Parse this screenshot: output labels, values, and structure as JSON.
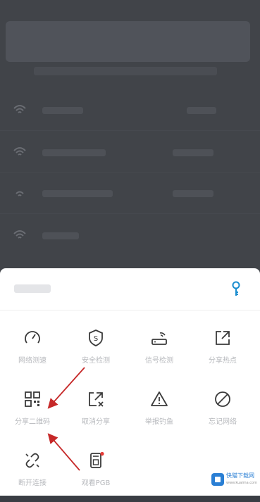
{
  "background_list": {
    "title": "",
    "rows": [
      {},
      {},
      {},
      {}
    ]
  },
  "sheet": {
    "title": "",
    "items": [
      {
        "label": "网络测速",
        "icon": "speedometer-icon"
      },
      {
        "label": "安全检测",
        "icon": "shield-icon"
      },
      {
        "label": "信号检测",
        "icon": "router-icon"
      },
      {
        "label": "分享热点",
        "icon": "share-out-icon"
      },
      {
        "label": "分享二维码",
        "icon": "qr-code-icon"
      },
      {
        "label": "取消分享",
        "icon": "share-cancel-icon"
      },
      {
        "label": "举报钓鱼",
        "icon": "warning-icon"
      },
      {
        "label": "忘记网络",
        "icon": "forbidden-icon"
      },
      {
        "label": "断开连接",
        "icon": "unlink-icon"
      },
      {
        "label": "观看PGB",
        "icon": "sim-card-icon"
      }
    ]
  },
  "watermark": {
    "brand": "快猫下载网",
    "url": "www.kuaima.com"
  },
  "colors": {
    "accent": "#1a8dcf",
    "arrow": "#c62828",
    "sheet_bg": "#ffffff",
    "overlay": "#414449"
  }
}
